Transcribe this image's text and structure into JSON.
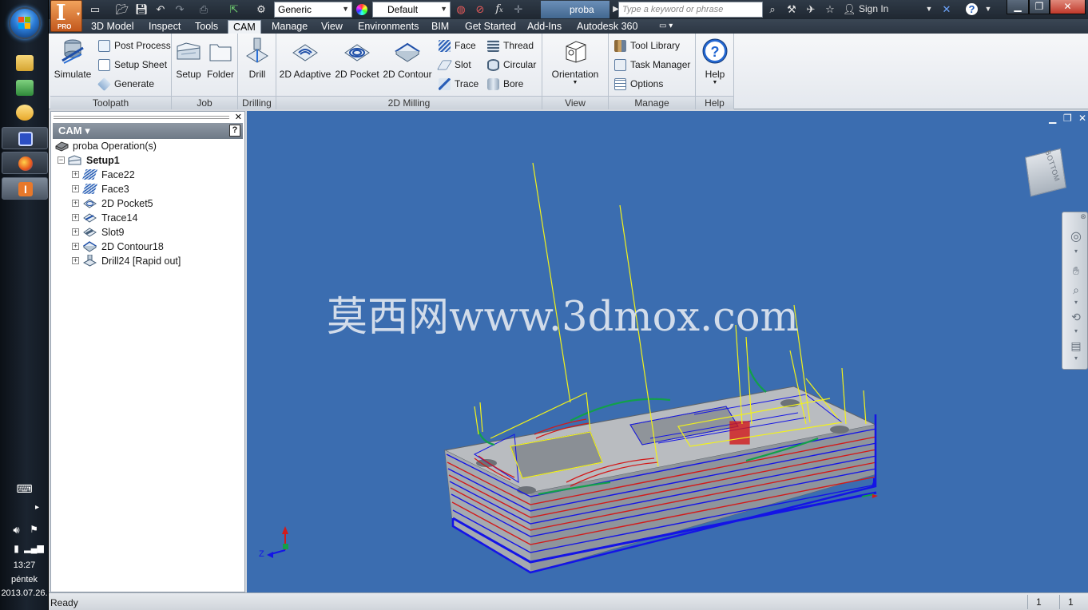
{
  "taskbar": {
    "time": "13:27",
    "day": "péntek",
    "date": "2013.07.26."
  },
  "qat": {
    "material_select": "Generic",
    "appearance_select": "Default",
    "document_tab": "proba",
    "search_placeholder": "Type a keyword or phrase",
    "sign_in": "Sign In"
  },
  "menu_tabs": [
    "3D Model",
    "Inspect",
    "Tools",
    "CAM",
    "Manage",
    "View",
    "Environments",
    "BIM",
    "Get Started",
    "Add-Ins",
    "Autodesk 360"
  ],
  "active_tab": "CAM",
  "ribbon": {
    "toolpath": {
      "title": "Toolpath",
      "simulate": "Simulate",
      "post_process": "Post Process",
      "setup_sheet": "Setup Sheet",
      "generate": "Generate"
    },
    "job": {
      "title": "Job",
      "setup": "Setup",
      "folder": "Folder"
    },
    "drilling": {
      "title": "Drilling",
      "drill": "Drill"
    },
    "milling2d": {
      "title": "2D Milling",
      "adaptive": "2D Adaptive",
      "pocket": "2D Pocket",
      "contour": "2D Contour",
      "face": "Face",
      "slot": "Slot",
      "trace": "Trace",
      "thread": "Thread",
      "circular": "Circular",
      "bore": "Bore"
    },
    "view": {
      "title": "View",
      "orientation": "Orientation"
    },
    "manage": {
      "title": "Manage",
      "tool_library": "Tool Library",
      "task_manager": "Task Manager",
      "options": "Options"
    },
    "help": {
      "title": "Help",
      "help": "Help"
    }
  },
  "browser": {
    "header": "CAM",
    "root": "proba Operation(s)",
    "setup": "Setup1",
    "operations": [
      "Face22",
      "Face3",
      "2D Pocket5",
      "Trace14",
      "Slot9",
      "2D Contour18",
      "Drill24 [Rapid out]"
    ]
  },
  "viewport": {
    "watermark": "莫西网www.3dmox.com",
    "viewcube_face": "BOTTOM",
    "axis_z": "Z"
  },
  "status": {
    "message": "Ready",
    "cell1": "1",
    "cell2": "1"
  },
  "colors": {
    "viewport_bg": "#3b6db0",
    "toolpath_blue": "#1414e6",
    "toolpath_red": "#d21a1a",
    "toolpath_yellow": "#f2f21a",
    "toolpath_green": "#12a04a",
    "part_gray": "#b9bcc0"
  }
}
